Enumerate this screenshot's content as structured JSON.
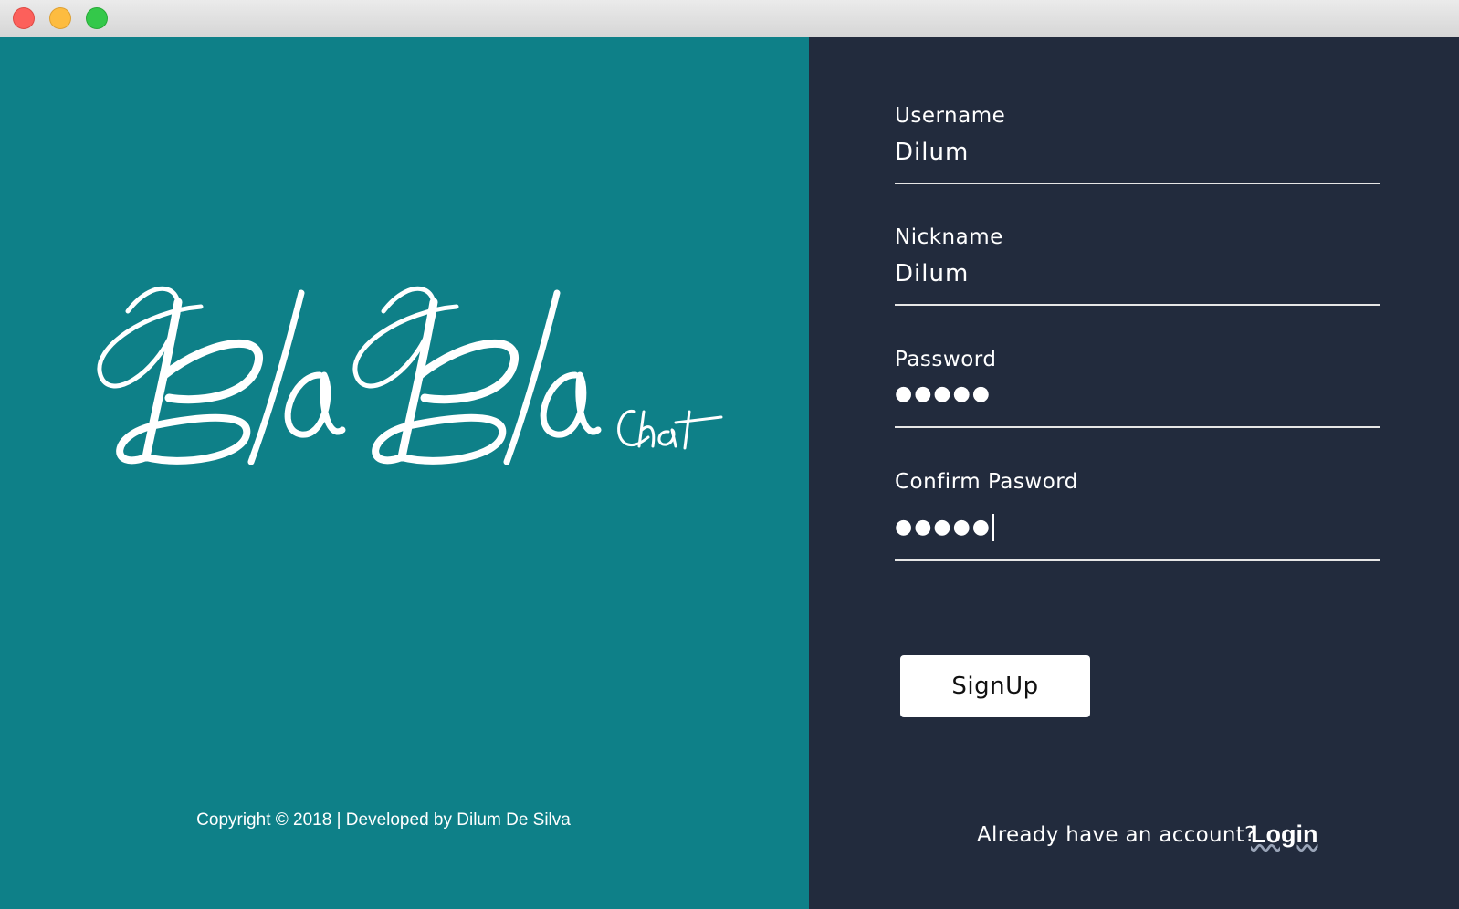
{
  "window": {
    "controls": [
      "close",
      "minimize",
      "zoom"
    ]
  },
  "brand": {
    "logo_text": "BlaBla",
    "logo_sub": "Chat",
    "copyright": "Copyright © 2018 | Developed by Dilum De Silva",
    "panel_color": "#0e8088"
  },
  "form": {
    "panel_color": "#222b3d",
    "username": {
      "label": "Username",
      "value": "Dilum"
    },
    "nickname": {
      "label": "Nickname",
      "value": "Dilum"
    },
    "password": {
      "label": "Password",
      "value": "●●●●●"
    },
    "confirm_password": {
      "label": "Confirm Pasword",
      "value": "●●●●●"
    },
    "signup_label": "SignUp",
    "already_text": "Already have an account?",
    "login_label": "Login"
  }
}
